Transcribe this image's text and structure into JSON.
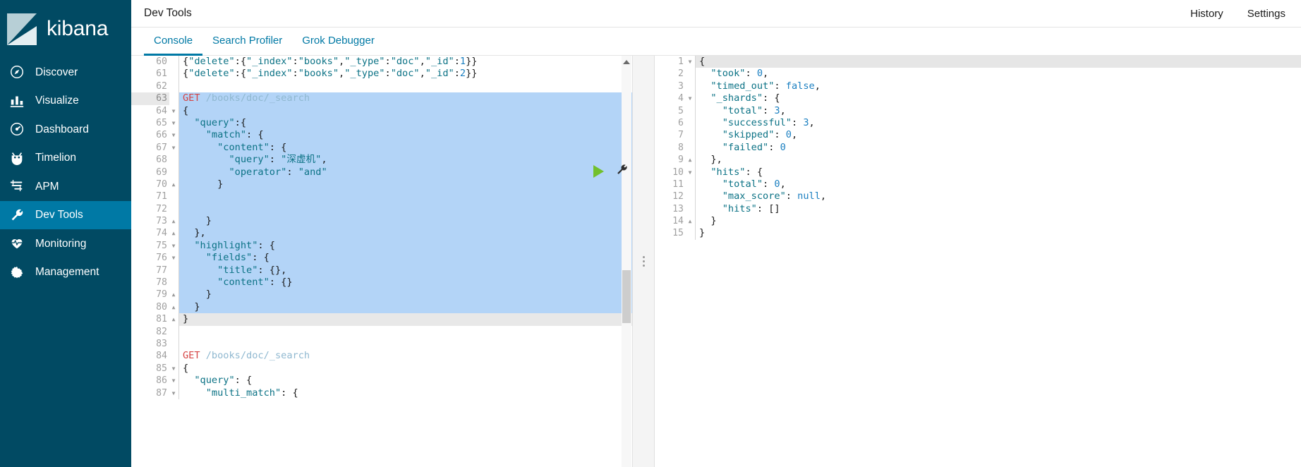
{
  "app": {
    "brand": "kibana",
    "brand_icon": "kibana-logo-icon"
  },
  "sidebar": {
    "items": [
      {
        "label": "Discover",
        "icon": "compass-icon",
        "active": false
      },
      {
        "label": "Visualize",
        "icon": "bar-chart-icon",
        "active": false
      },
      {
        "label": "Dashboard",
        "icon": "dashboard-icon",
        "active": false
      },
      {
        "label": "Timelion",
        "icon": "timelion-icon",
        "active": false
      },
      {
        "label": "APM",
        "icon": "apm-icon",
        "active": false
      },
      {
        "label": "Dev Tools",
        "icon": "wrench-icon",
        "active": true
      },
      {
        "label": "Monitoring",
        "icon": "heartbeat-icon",
        "active": false
      },
      {
        "label": "Management",
        "icon": "gear-icon",
        "active": false
      }
    ]
  },
  "header": {
    "title": "Dev Tools",
    "links": [
      {
        "label": "History"
      },
      {
        "label": "Settings"
      }
    ]
  },
  "tabs": [
    {
      "label": "Console",
      "active": true
    },
    {
      "label": "Search Profiler",
      "active": false
    },
    {
      "label": "Grok Debugger",
      "active": false
    }
  ],
  "actions": {
    "play_label": "Click to send request",
    "play_icon": "play-triangle-icon",
    "wrench_icon": "wrench-icon"
  },
  "editor": {
    "first_line_number": 60,
    "current_line": 63,
    "selection_start_line": 63,
    "selection_end_line": 80,
    "lines": [
      {
        "n": 60,
        "fold": "",
        "text": "{\"delete\":{\"_index\":\"books\",\"_type\":\"doc\",\"_id\":1}}"
      },
      {
        "n": 61,
        "fold": "",
        "text": "{\"delete\":{\"_index\":\"books\",\"_type\":\"doc\",\"_id\":2}}"
      },
      {
        "n": 62,
        "fold": "",
        "text": ""
      },
      {
        "n": 63,
        "fold": "",
        "text": "GET /books/doc/_search"
      },
      {
        "n": 64,
        "fold": "v",
        "text": "{"
      },
      {
        "n": 65,
        "fold": "v",
        "text": "  \"query\":{"
      },
      {
        "n": 66,
        "fold": "v",
        "text": "    \"match\": {"
      },
      {
        "n": 67,
        "fold": "v",
        "text": "      \"content\": {"
      },
      {
        "n": 68,
        "fold": "",
        "text": "        \"query\": \"深虚机\","
      },
      {
        "n": 69,
        "fold": "",
        "text": "        \"operator\": \"and\""
      },
      {
        "n": 70,
        "fold": "^",
        "text": "      }"
      },
      {
        "n": 71,
        "fold": "",
        "text": ""
      },
      {
        "n": 72,
        "fold": "",
        "text": ""
      },
      {
        "n": 73,
        "fold": "^",
        "text": "    }"
      },
      {
        "n": 74,
        "fold": "^",
        "text": "  },"
      },
      {
        "n": 75,
        "fold": "v",
        "text": "  \"highlight\": {"
      },
      {
        "n": 76,
        "fold": "v",
        "text": "    \"fields\": {"
      },
      {
        "n": 77,
        "fold": "",
        "text": "      \"title\": {},"
      },
      {
        "n": 78,
        "fold": "",
        "text": "      \"content\": {}"
      },
      {
        "n": 79,
        "fold": "^",
        "text": "    }"
      },
      {
        "n": 80,
        "fold": "^",
        "text": "  }"
      },
      {
        "n": 81,
        "fold": "^",
        "text": "}"
      },
      {
        "n": 82,
        "fold": "",
        "text": ""
      },
      {
        "n": 83,
        "fold": "",
        "text": ""
      },
      {
        "n": 84,
        "fold": "",
        "text": "GET /books/doc/_search"
      },
      {
        "n": 85,
        "fold": "v",
        "text": "{"
      },
      {
        "n": 86,
        "fold": "v",
        "text": "  \"query\": {"
      },
      {
        "n": 87,
        "fold": "v",
        "text": "    \"multi_match\": {"
      }
    ]
  },
  "response": {
    "first_line_number": 1,
    "lines": [
      {
        "n": 1,
        "fold": "v",
        "text": "{"
      },
      {
        "n": 2,
        "fold": "",
        "text": "  \"took\": 0,"
      },
      {
        "n": 3,
        "fold": "",
        "text": "  \"timed_out\": false,"
      },
      {
        "n": 4,
        "fold": "v",
        "text": "  \"_shards\": {"
      },
      {
        "n": 5,
        "fold": "",
        "text": "    \"total\": 3,"
      },
      {
        "n": 6,
        "fold": "",
        "text": "    \"successful\": 3,"
      },
      {
        "n": 7,
        "fold": "",
        "text": "    \"skipped\": 0,"
      },
      {
        "n": 8,
        "fold": "",
        "text": "    \"failed\": 0"
      },
      {
        "n": 9,
        "fold": "^",
        "text": "  },"
      },
      {
        "n": 10,
        "fold": "v",
        "text": "  \"hits\": {"
      },
      {
        "n": 11,
        "fold": "",
        "text": "    \"total\": 0,"
      },
      {
        "n": 12,
        "fold": "",
        "text": "    \"max_score\": null,"
      },
      {
        "n": 13,
        "fold": "",
        "text": "    \"hits\": []"
      },
      {
        "n": 14,
        "fold": "^",
        "text": "  }"
      },
      {
        "n": 15,
        "fold": "",
        "text": "}"
      }
    ]
  },
  "colors": {
    "sidebar_bg": "#014a63",
    "sidebar_active": "#0079a5",
    "accent": "#0079a5",
    "selection": "#b3d4f7",
    "play_green": "#72c02c",
    "string_token": "#0b7285",
    "number_token": "#1a7fc1",
    "method_token": "#d64545",
    "url_token": "#8fb8d0"
  }
}
